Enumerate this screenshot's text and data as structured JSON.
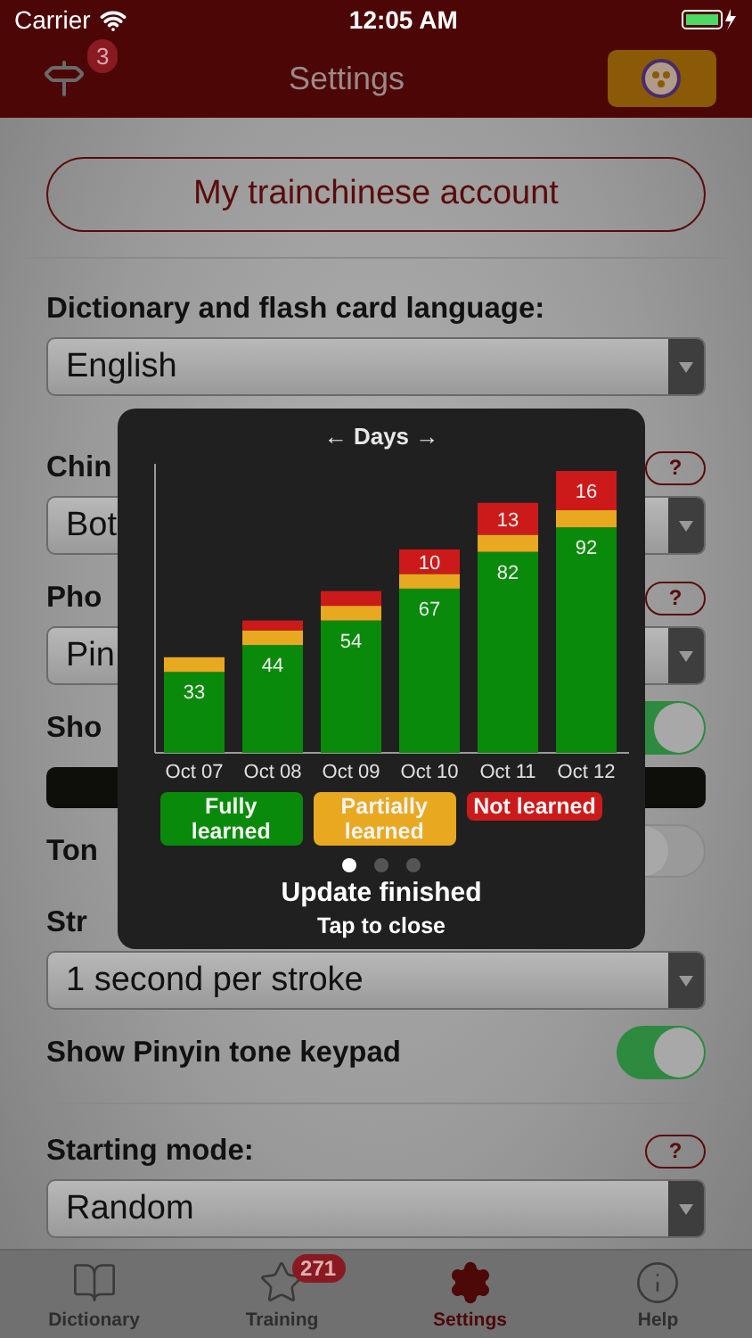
{
  "status_bar": {
    "carrier": "Carrier",
    "time": "12:05 AM"
  },
  "nav": {
    "title": "Settings",
    "badge": "3"
  },
  "account_button": "My trainchinese account",
  "groups": [
    [
      {
        "kind": "select",
        "label": "Dictionary and flash card language:",
        "value": "English"
      },
      {
        "kind": "select",
        "label": "Chin",
        "value": "Bot",
        "help": "?"
      },
      {
        "kind": "select",
        "label": "Pho",
        "value": "Pin",
        "help": "?"
      },
      {
        "kind": "toggle",
        "label": "Sho",
        "on": true,
        "sample_bar": true
      },
      {
        "kind": "toggle",
        "label": "Ton",
        "on": false
      },
      {
        "kind": "select",
        "label": "Str",
        "value": "1 second per stroke"
      },
      {
        "kind": "toggle",
        "label": "Show Pinyin tone keypad",
        "on": true
      }
    ],
    [
      {
        "kind": "select",
        "label": "Starting mode:",
        "value": "Random",
        "help": "?"
      }
    ]
  ],
  "popup": {
    "nav_label": "← Days →",
    "chart_data": {
      "type": "bar",
      "stacked": true,
      "categories": [
        "Oct 07",
        "Oct 08",
        "Oct 09",
        "Oct 10",
        "Oct 11",
        "Oct 12"
      ],
      "series": [
        {
          "name": "Fully learned",
          "color": "#0a8a0a",
          "values": [
            33,
            44,
            54,
            67,
            82,
            92
          ],
          "value_labels": [
            "33",
            "44",
            "54",
            "67",
            "82",
            "92"
          ]
        },
        {
          "name": "Partially learned",
          "color": "#e8a820",
          "values": [
            6,
            6,
            6,
            6,
            7,
            7
          ],
          "value_labels": [
            null,
            null,
            null,
            null,
            null,
            null
          ]
        },
        {
          "name": "Not learned",
          "color": "#cc1a1a",
          "values": [
            null,
            4,
            6,
            10,
            13,
            16
          ],
          "value_labels": [
            null,
            null,
            null,
            "10",
            "13",
            "16"
          ]
        }
      ]
    },
    "pages": [
      {
        "selected": true
      },
      {
        "selected": false
      },
      {
        "selected": false
      }
    ],
    "title": "Update finished",
    "subtitle": "Tap to close"
  },
  "tabs": [
    {
      "label": "Dictionary",
      "selected": false
    },
    {
      "label": "Training",
      "selected": false,
      "badge": "271"
    },
    {
      "label": "Settings",
      "selected": true
    },
    {
      "label": "Help",
      "selected": false
    }
  ]
}
